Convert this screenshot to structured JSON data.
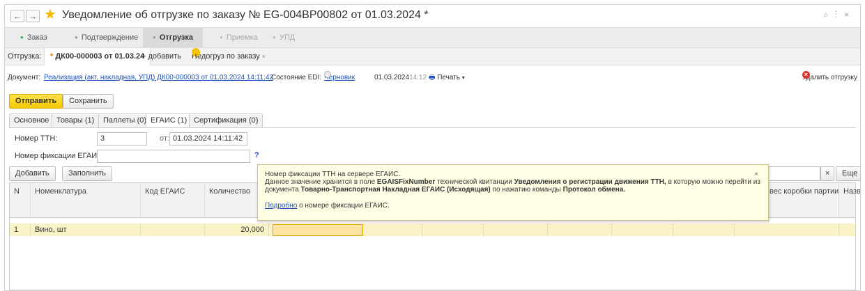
{
  "window": {
    "back": "←",
    "forward": "→",
    "title": "Уведомление об отгрузке по заказу № EG-004BP00802 от 01.03.2024 *",
    "link_icon": "link-icon",
    "more": "⋮",
    "close": "×"
  },
  "steps": [
    {
      "label": "Заказ",
      "state": "done",
      "dot_color": "#3aa04a"
    },
    {
      "label": "Подтверждение",
      "state": "normal",
      "dot_color": "#999999"
    },
    {
      "label": "Отгрузка",
      "state": "active",
      "dot_color": "#999999"
    },
    {
      "label": "Приемка",
      "state": "dim",
      "dot_color": "#bbbbbb"
    },
    {
      "label": "УПД",
      "state": "dim",
      "dot_color": "#bbbbbb"
    }
  ],
  "shipment_bar": {
    "label": "Отгрузка:",
    "current_tab": "ДК00-000003 от 01.03.24",
    "add": "+ добавить",
    "warning_tab": "Недогруз по заказу",
    "warning_close": "×"
  },
  "info": {
    "document_label": "Документ:",
    "document_link": "Реализация (акт, накладная, УПД) ДК00-000003 от 01.03.2024 14:11:42",
    "edi_label": "Состояние EDI:",
    "edi_status": "Черновик",
    "edi_date": "01.03.2024",
    "edi_time": "14:12",
    "print": "Печать",
    "delete": "Удалить отгрузку"
  },
  "toolbar": {
    "send": "Отправить",
    "save": "Сохранить"
  },
  "tabs": [
    "Основное",
    "Товары (1)",
    "Паллеты (0)",
    "ЕГАИС (1)",
    "Сертификация (0)"
  ],
  "form": {
    "ttn_label": "Номер ТТН:",
    "ttn_value": "3",
    "from_label": "от:",
    "from_value": "01.03.2024 14:11:42",
    "fix_label": "Номер фиксации ЕГАИС:",
    "fix_value": "",
    "help": "?"
  },
  "table_toolbar": {
    "add": "Добавить",
    "fill": "Заполнить",
    "clear": "×",
    "more": "Еще"
  },
  "table": {
    "headers": [
      "N",
      "Номенклатура",
      "Код ЕГАИС",
      "Количество",
      "",
      "",
      "",
      "",
      "",
      "",
      "вес коробки партии, кг",
      "Назва"
    ],
    "rows": [
      {
        "n": "1",
        "name": "Вино, шт",
        "code": "",
        "qty": "20,000"
      }
    ]
  },
  "tooltip": {
    "line1": "Номер фиксации ТТН на сервере ЕГАИС.",
    "line2_a": "Данное значение хранится в поле ",
    "line2_b": "EGAISFixNumber",
    "line2_c": " технической квитанции ",
    "line2_d": "Уведомления о регистрации движения ТТН,",
    "line2_e": " в которую можно перейти из",
    "line3_a": "документа ",
    "line3_b": "Товарно-Транспортная Накладная ЕГАИС (Исходящая)",
    "line3_c": " по нажатию команды ",
    "line3_d": "Протокол обмена.",
    "link": "Подробно",
    "link_tail": " о номере фиксации ЕГАИС.",
    "close": "×"
  },
  "colors": {
    "accent": "#f5c800",
    "link": "#1a4fbf",
    "row_highlight": "#fbf3c8",
    "tooltip_bg": "#ffffe6"
  }
}
